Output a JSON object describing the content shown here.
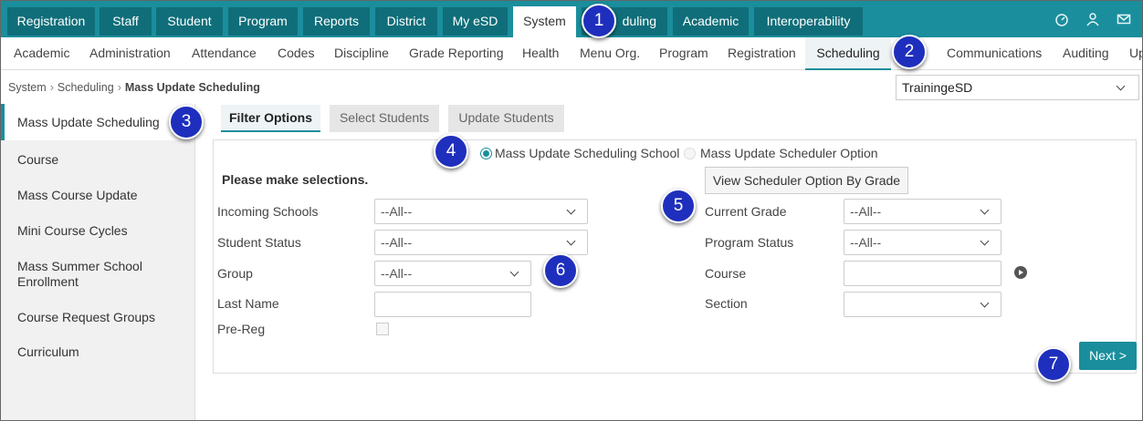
{
  "top_tabs": [
    "Registration",
    "Staff",
    "Student",
    "Program",
    "Reports",
    "District",
    "My eSD",
    "System",
    "Scheduling",
    "Academic",
    "Interoperability"
  ],
  "top_tab_visible_texts": [
    "Registration",
    "Staff",
    "Student",
    "Program",
    "Reports",
    "District",
    "My eSD",
    "System",
    "duling",
    "Academic",
    "Interoperability"
  ],
  "top_icons": [
    "dashboard-icon",
    "user-icon",
    "mail-icon"
  ],
  "sub_nav": [
    "Academic",
    "Administration",
    "Attendance",
    "Codes",
    "Discipline",
    "Grade Reporting",
    "Health",
    "Menu Org.",
    "Program",
    "Registration",
    "Scheduling",
    "Communications",
    "Auditing",
    "Up"
  ],
  "breadcrumb": {
    "items": [
      "System",
      "Scheduling"
    ],
    "current": "Mass Update Scheduling"
  },
  "district_select": "TrainingeSD",
  "sidebar": [
    "Mass Update Scheduling",
    "Course",
    "Mass Course Update",
    "Mini Course Cycles",
    "Mass Summer School Enrollment",
    "Course Request Groups",
    "Curriculum"
  ],
  "filter_tabs": [
    "Filter Options",
    "Select Students",
    "Update Students"
  ],
  "radio_options": [
    "Mass Update Scheduling School",
    "Mass Update Scheduler Option"
  ],
  "view_option_button": "View Scheduler Option By Grade",
  "instruction": "Please make selections.",
  "form_left": {
    "incoming_schools": {
      "label": "Incoming Schools",
      "value": "--All--"
    },
    "student_status": {
      "label": "Student Status",
      "value": "--All--"
    },
    "group": {
      "label": "Group",
      "value": "--All--"
    },
    "last_name": {
      "label": "Last Name",
      "value": ""
    },
    "pre_reg": {
      "label": "Pre-Reg"
    }
  },
  "form_right": {
    "current_grade": {
      "label": "Current Grade",
      "value": "--All--"
    },
    "program_status": {
      "label": "Program Status",
      "value": "--All--"
    },
    "course": {
      "label": "Course",
      "value": ""
    },
    "section": {
      "label": "Section",
      "value": ""
    }
  },
  "next_button": "Next >",
  "callouts": [
    "1",
    "2",
    "3",
    "4",
    "5",
    "6",
    "7"
  ],
  "colors": {
    "teal": "#1a8e9c",
    "dark_teal": "#0f6e79",
    "callout_blue": "#1f2fbd"
  }
}
